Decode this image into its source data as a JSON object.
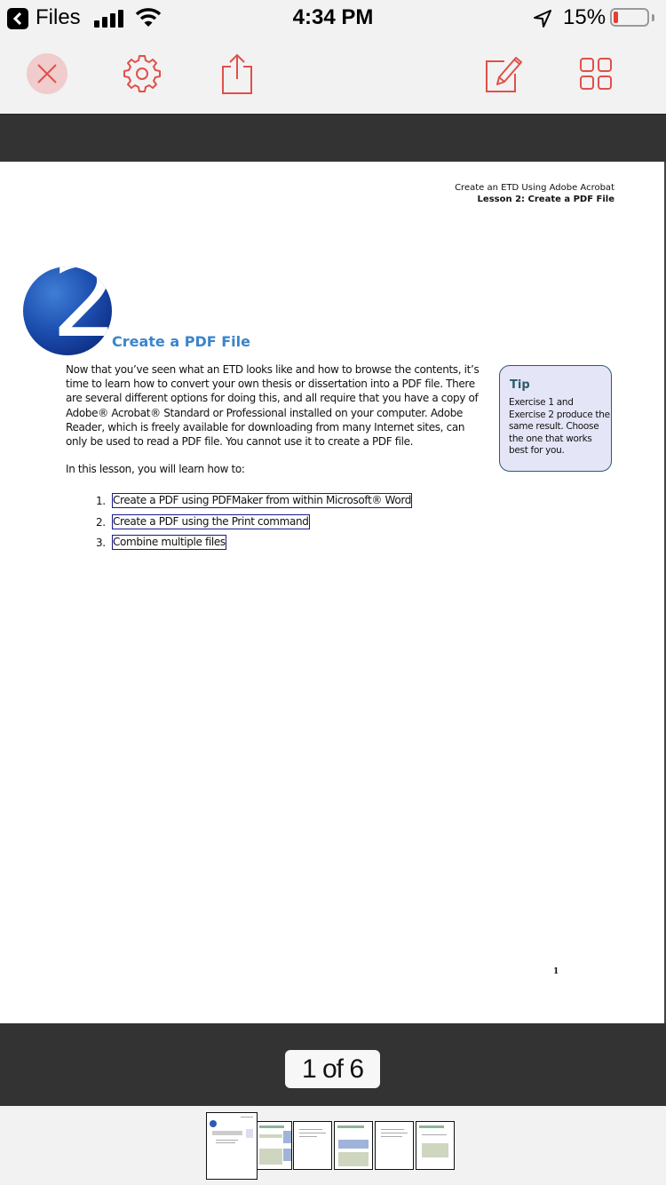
{
  "status_bar": {
    "back_app": "Files",
    "time": "4:34 PM",
    "battery_percent": "15%",
    "battery_level": 0.15
  },
  "toolbar": {
    "buttons": [
      {
        "name": "close",
        "icon": "close-icon"
      },
      {
        "name": "settings",
        "icon": "gear-icon"
      },
      {
        "name": "share",
        "icon": "share-icon"
      },
      {
        "name": "annotate",
        "icon": "edit-icon"
      },
      {
        "name": "thumbnails",
        "icon": "grid-icon"
      }
    ],
    "accent_color": "#e0504a"
  },
  "document": {
    "header_line1": "Create an ETD Using Adobe Acrobat",
    "header_line2": "Lesson 2: Create a PDF File",
    "chapter_number": "2",
    "chapter_title": "Create a PDF File",
    "body": "Now that you’ve seen what an ETD looks like and how to browse the contents, it’s time to learn how to convert your own thesis or dissertation into a PDF file. There are several different options for doing this, and all require that you have a copy of Adobe® Acrobat® Standard or Professional installed on your computer. Adobe Reader, which is freely available for downloading from many Internet sites, can only be used to read a PDF file. You cannot use it to create a PDF file.",
    "intro": "In this lesson, you will learn how to:",
    "steps": [
      {
        "num": "1.",
        "text": "Create a PDF using PDFMaker from within Microsoft® Word"
      },
      {
        "num": "2.",
        "text": "Create a PDF using the Print command"
      },
      {
        "num": "3.",
        "text": "Combine multiple files"
      }
    ],
    "tip": {
      "title": "Tip",
      "text": "Exercise 1 and Exercise 2 produce the same result. Choose the one that works best for you."
    },
    "page_number": "1"
  },
  "pager": {
    "label": "1 of 6",
    "current": 1,
    "total": 6
  },
  "thumbnails": [
    {
      "page": 1,
      "selected": true
    },
    {
      "page": 2,
      "selected": false
    },
    {
      "page": 3,
      "selected": false
    },
    {
      "page": 4,
      "selected": false
    },
    {
      "page": 5,
      "selected": false
    },
    {
      "page": 6,
      "selected": false
    }
  ]
}
